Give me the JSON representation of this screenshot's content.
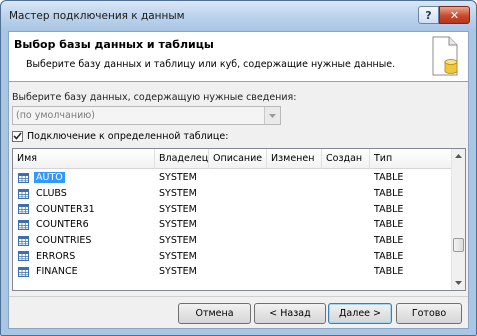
{
  "window": {
    "title": "Мастер подключения к данным",
    "help_label": "?",
    "close_label": "✕"
  },
  "header": {
    "title": "Выбор базы данных и таблицы",
    "subtitle": "Выберите базу данных и таблицу или куб, содержащие нужные данные.",
    "icon": "database-document-icon"
  },
  "database": {
    "label": "Выберите базу данных, содержащую нужные сведения:",
    "value": "(по умолчанию)",
    "dropdown_icon": "chevron-down-icon"
  },
  "connect_table": {
    "label": "Подключение к определенной таблице:",
    "checked": true
  },
  "table": {
    "columns": [
      "Имя",
      "Владелец",
      "Описание",
      "Изменен",
      "Создан",
      "Тип"
    ],
    "rows": [
      {
        "name": "AUTO",
        "owner": "SYSTEM",
        "description": "",
        "modified": "",
        "created": "",
        "type": "TABLE",
        "selected": true
      },
      {
        "name": "CLUBS",
        "owner": "SYSTEM",
        "description": "",
        "modified": "",
        "created": "",
        "type": "TABLE"
      },
      {
        "name": "COUNTER31",
        "owner": "SYSTEM",
        "description": "",
        "modified": "",
        "created": "",
        "type": "TABLE"
      },
      {
        "name": "COUNTER6",
        "owner": "SYSTEM",
        "description": "",
        "modified": "",
        "created": "",
        "type": "TABLE"
      },
      {
        "name": "COUNTRIES",
        "owner": "SYSTEM",
        "description": "",
        "modified": "",
        "created": "",
        "type": "TABLE"
      },
      {
        "name": "ERRORS",
        "owner": "SYSTEM",
        "description": "",
        "modified": "",
        "created": "",
        "type": "TABLE"
      },
      {
        "name": "FINANCE",
        "owner": "SYSTEM",
        "description": "",
        "modified": "",
        "created": "",
        "type": "TABLE"
      }
    ],
    "row_icon": "table-icon"
  },
  "buttons": {
    "cancel": "Отмена",
    "back": "< Назад",
    "next": "Далее >",
    "finish": "Готово"
  },
  "colors": {
    "selection": "#3399ff",
    "frame": "#a9c6e4"
  }
}
